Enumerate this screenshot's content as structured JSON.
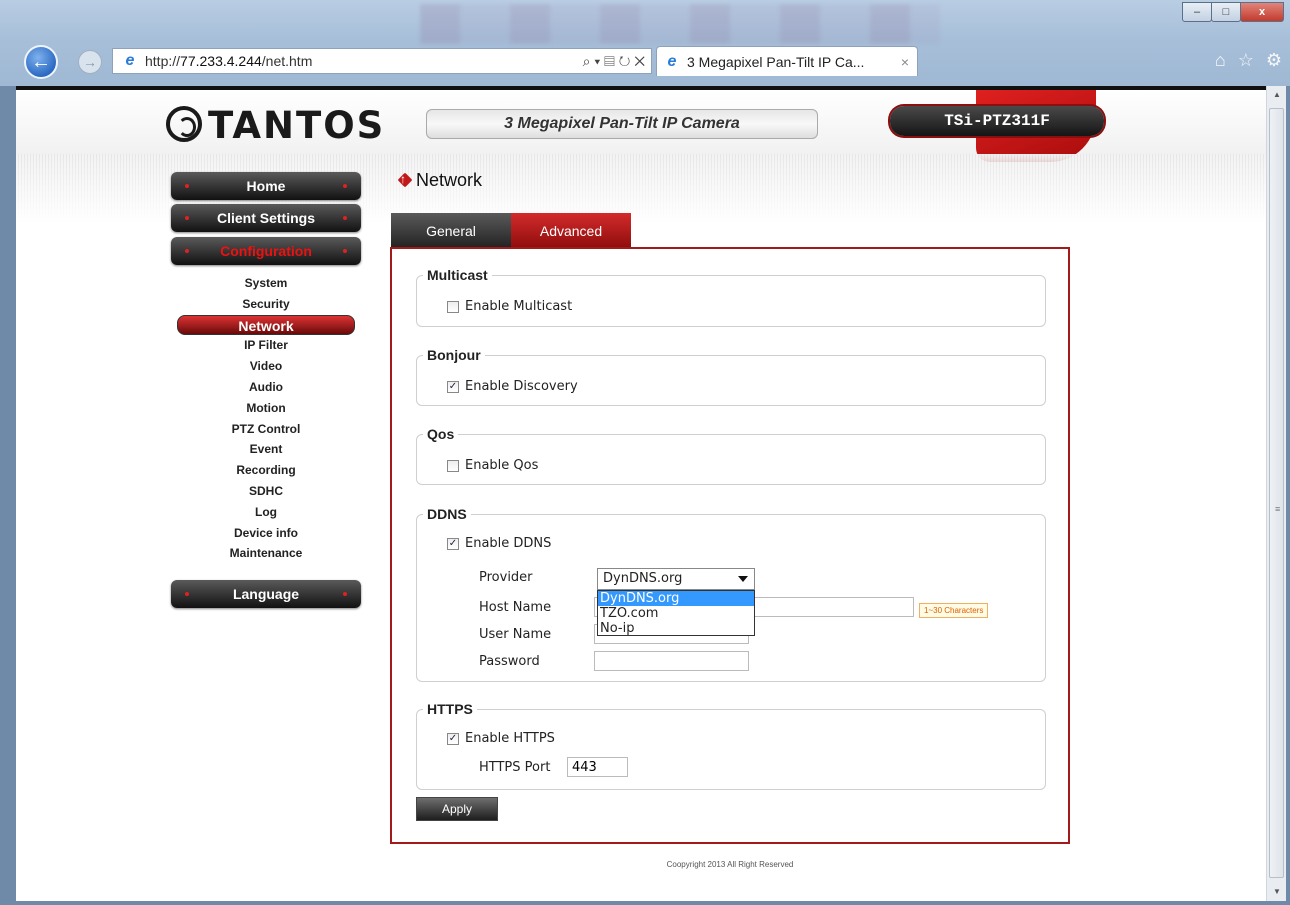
{
  "browser": {
    "url_prefix": "http://",
    "url_host": "77.233.4.244",
    "url_path": "/net.htm",
    "address_tools": "⌕ ▾ ▤ ↻ ✕",
    "tab_title": "3 Megapixel Pan-Tilt IP Ca...",
    "tab_close": "×",
    "window_buttons": {
      "minimize": "–",
      "maximize": "□",
      "close": "x"
    }
  },
  "header": {
    "brand": "TANTOS",
    "product_title": "3 Megapixel Pan-Tilt IP Camera",
    "model": "TSi-PTZ311F"
  },
  "sidebar": {
    "home": "Home",
    "client_settings": "Client Settings",
    "configuration": "Configuration",
    "items": [
      "System",
      "Security",
      "Network",
      "IP Filter",
      "Video",
      "Audio",
      "Motion",
      "PTZ Control",
      "Event",
      "Recording",
      "SDHC",
      "Log",
      "Device info",
      "Maintenance"
    ],
    "active_item": "Network",
    "language": "Language"
  },
  "page": {
    "title": "Network",
    "tabs": {
      "general": "General",
      "advanced": "Advanced"
    },
    "active_tab": "Advanced"
  },
  "multicast": {
    "legend": "Multicast",
    "enable_label": "Enable Multicast",
    "checked": false
  },
  "bonjour": {
    "legend": "Bonjour",
    "enable_label": "Enable Discovery",
    "checked": true
  },
  "qos": {
    "legend": "Qos",
    "enable_label": "Enable Qos",
    "checked": false
  },
  "ddns": {
    "legend": "DDNS",
    "enable_label": "Enable DDNS",
    "checked": true,
    "provider_label": "Provider",
    "provider_value": "DynDNS.org",
    "provider_options": [
      "DynDNS.org",
      "TZO.com",
      "No-ip"
    ],
    "host_label": "Host Name",
    "host_value": "",
    "host_hint": "1~30 Characters",
    "user_label": "User Name",
    "user_value": "",
    "password_label": "Password",
    "password_value": ""
  },
  "https": {
    "legend": "HTTPS",
    "enable_label": "Enable HTTPS",
    "checked": true,
    "port_label": "HTTPS Port",
    "port_value": "443"
  },
  "apply_label": "Apply",
  "copyright": "Coopyright 2013 All Right Reserved",
  "colors": {
    "brand_red": "#a31a1a",
    "dark_button": "#1e1e1e",
    "selection_blue": "#3399ff"
  }
}
